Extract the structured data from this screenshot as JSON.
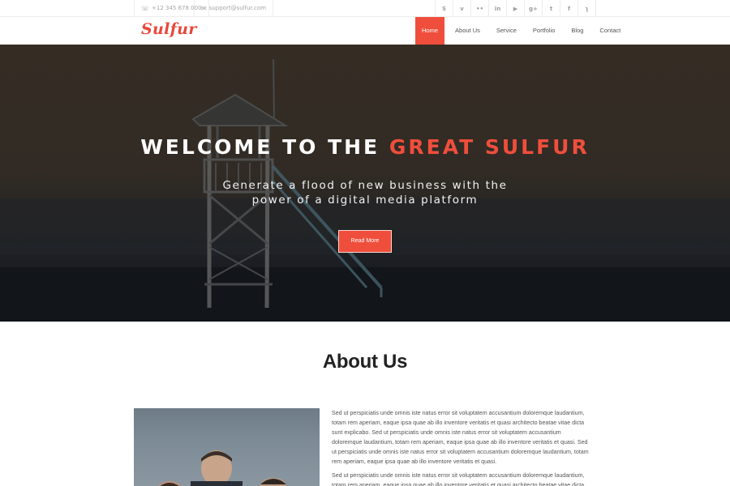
{
  "topbar": {
    "phone": "+12 345 678 000",
    "email": "support@sulfur.com",
    "phone_icon": "phone-icon",
    "email_icon": "envelope-icon",
    "social": [
      {
        "name": "skype-icon",
        "glyph": "S"
      },
      {
        "name": "vimeo-icon",
        "glyph": "v"
      },
      {
        "name": "flickr-icon",
        "glyph": "••"
      },
      {
        "name": "linkedin-icon",
        "glyph": "in"
      },
      {
        "name": "youtube-icon",
        "glyph": "▶"
      },
      {
        "name": "google-plus-icon",
        "glyph": "g+"
      },
      {
        "name": "twitter-icon",
        "glyph": "t"
      },
      {
        "name": "facebook-icon",
        "glyph": "f"
      },
      {
        "name": "rss-icon",
        "glyph": "ʅ"
      }
    ]
  },
  "navbar": {
    "logo": "Sulfur",
    "items": [
      "Home",
      "About Us",
      "Service",
      "Portfolio",
      "Blog",
      "Contact"
    ],
    "active": "Home"
  },
  "hero": {
    "title_prefix": "WELCOME TO THE",
    "title_accent": "GREAT SULFUR",
    "subtitle_line1": "Generate a flood of new business with the",
    "subtitle_line2": "power of a digital media platform",
    "button": "Read More"
  },
  "about": {
    "title": "About Us",
    "paragraph1": "Sed ut perspiciatis unde omnis iste natus error sit voluptatem accusantium doloremque laudantium, totam rem aperiam, eaque ipsa quae ab illo inventore veritatis et quasi architecto beatae vitae dicta sunt explicabo. Sed ut perspiciatis unde omnis iste natus error sit voluptatem accusantium doloremque laudantium, totam rem aperiam, eaque ipsa quae ab illo inventore veritatis et quasi. Sed ut perspiciatis unde omnis iste natus error sit voluptatem accusantium doloremque laudantium, totam rem aperiam, eaque ipsa quae ab illo inventore veritatis et quasi.",
    "paragraph2": "Sed ut perspiciatis unde omnis iste natus error sit voluptatem accusantium doloremque laudantium, totam rem aperiam, eaque ipsa quae ab illo inventore veritatis et quasi architecto beatae vitae dicta sunt explicabo."
  },
  "colors": {
    "accent": "#f04e3c",
    "logo": "#e8473a"
  }
}
